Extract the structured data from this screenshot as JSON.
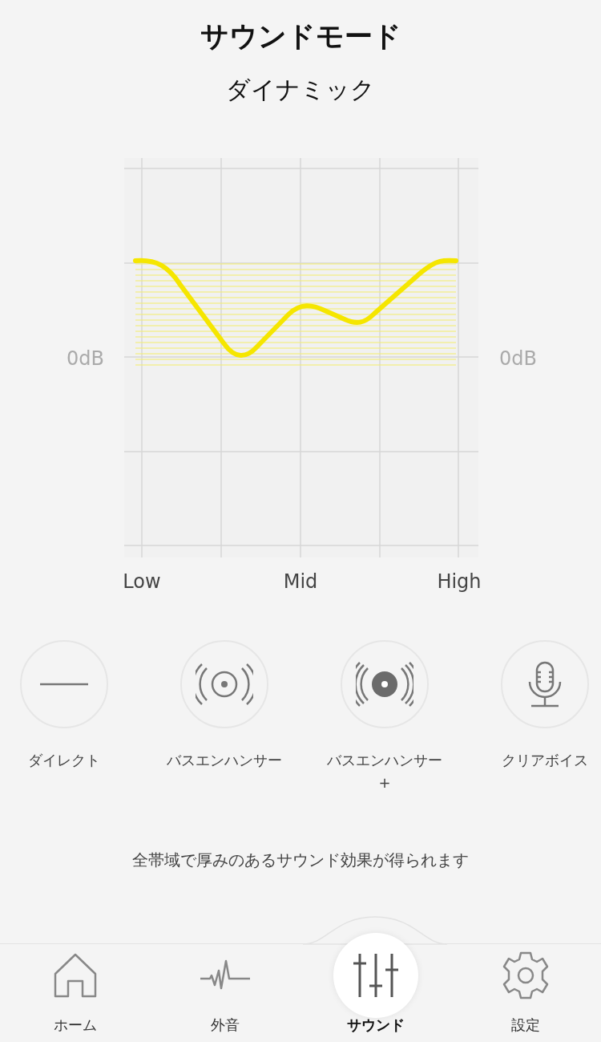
{
  "title": "サウンドモード",
  "mode_name": "ダイナミック",
  "eq_chart": {
    "left_label": "0dB",
    "right_label": "0dB",
    "x_labels": [
      "Low",
      "Mid",
      "High"
    ]
  },
  "modes": [
    {
      "label": "ダイレクト"
    },
    {
      "label": "バスエンハンサー"
    },
    {
      "label": "バスエンハンサー\n+"
    },
    {
      "label": "クリアボイス"
    }
  ],
  "description": "全帯域で厚みのあるサウンド効果が得られます",
  "tab_bar": [
    {
      "label": "ホーム",
      "selected": false
    },
    {
      "label": "外音",
      "selected": false
    },
    {
      "label": "サウンド",
      "selected": true
    },
    {
      "label": "設定",
      "selected": false
    }
  ]
}
